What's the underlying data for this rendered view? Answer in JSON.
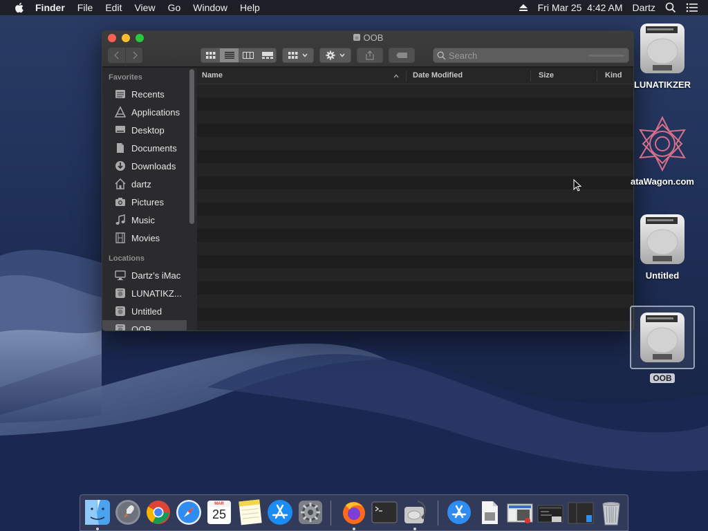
{
  "menubar": {
    "app_name": "Finder",
    "menus": [
      "File",
      "Edit",
      "View",
      "Go",
      "Window",
      "Help"
    ],
    "datetime": "Fri Mar 25  4:42 AM",
    "user": "Dartz"
  },
  "window": {
    "title": "OOB",
    "search_placeholder": "Search",
    "columns": {
      "name": "Name",
      "date_modified": "Date Modified",
      "size": "Size",
      "kind": "Kind"
    },
    "sidebar": {
      "favorites_header": "Favorites",
      "favorites": [
        {
          "label": "Recents",
          "icon": "recents-icon"
        },
        {
          "label": "Applications",
          "icon": "applications-icon"
        },
        {
          "label": "Desktop",
          "icon": "desktop-icon"
        },
        {
          "label": "Documents",
          "icon": "documents-icon"
        },
        {
          "label": "Downloads",
          "icon": "downloads-icon"
        },
        {
          "label": "dartz",
          "icon": "home-icon"
        },
        {
          "label": "Pictures",
          "icon": "camera-icon"
        },
        {
          "label": "Music",
          "icon": "music-note-icon"
        },
        {
          "label": "Movies",
          "icon": "film-icon"
        }
      ],
      "locations_header": "Locations",
      "locations": [
        {
          "label": "Dartz’s iMac",
          "icon": "computer-icon"
        },
        {
          "label": "LUNATIKZ...",
          "icon": "drive-icon"
        },
        {
          "label": "Untitled",
          "icon": "drive-icon"
        },
        {
          "label": "OOB",
          "icon": "drive-icon"
        }
      ]
    }
  },
  "desktop": {
    "icons": [
      {
        "label": "LUNATIKZER",
        "icon": "hard-drive-icon"
      },
      {
        "label": "ataWagon.com",
        "icon": "star-emblem-icon"
      },
      {
        "label": "Untitled",
        "icon": "hard-drive-icon"
      },
      {
        "label": "OOB",
        "icon": "hard-drive-icon",
        "selected": true
      }
    ]
  },
  "dock": {
    "apps": [
      "Finder",
      "Launchpad",
      "Chrome",
      "Safari",
      "Calendar",
      "Notes",
      "App Store",
      "System Preferences",
      "Firefox",
      "Terminal",
      "Disk Utility",
      "Utilities Folder",
      "Documents Stack",
      "Screenshots Stack",
      "Window Stack",
      "Trash"
    ],
    "calendar_month": "MAR",
    "calendar_day": "25"
  }
}
